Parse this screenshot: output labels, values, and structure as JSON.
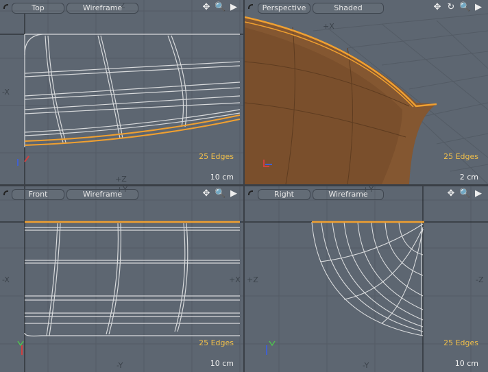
{
  "viewports": [
    {
      "view": "Top",
      "mode": "Wireframe",
      "edges": "25 Edges",
      "scale": "10 cm",
      "axes": {
        "left": "-X",
        "bottom": "+Z",
        "top": "Z"
      }
    },
    {
      "view": "Perspective",
      "mode": "Shaded",
      "edges": "25 Edges",
      "scale": "2 cm",
      "axes": {
        "top": "+X"
      }
    },
    {
      "view": "Front",
      "mode": "Wireframe",
      "edges": "25 Edges",
      "scale": "10 cm",
      "axes": {
        "left": "-X",
        "right": "+X",
        "bottom": "-Y",
        "top": "+Y"
      }
    },
    {
      "view": "Right",
      "mode": "Wireframe",
      "edges": "25 Edges",
      "scale": "10 cm",
      "axes": {
        "left": "+Z",
        "right": "-Z",
        "bottom": "-Y",
        "top": "+Y"
      }
    }
  ],
  "tools": {
    "pan": "✥",
    "rotate": "↻",
    "zoom": "🔍",
    "menu": "▶"
  },
  "colors": {
    "background": "#5d6671",
    "selection": "#f0a030",
    "edges_text": "#f2c04a",
    "wire": "#d8dadc",
    "mesh": "#7a4f2c"
  }
}
